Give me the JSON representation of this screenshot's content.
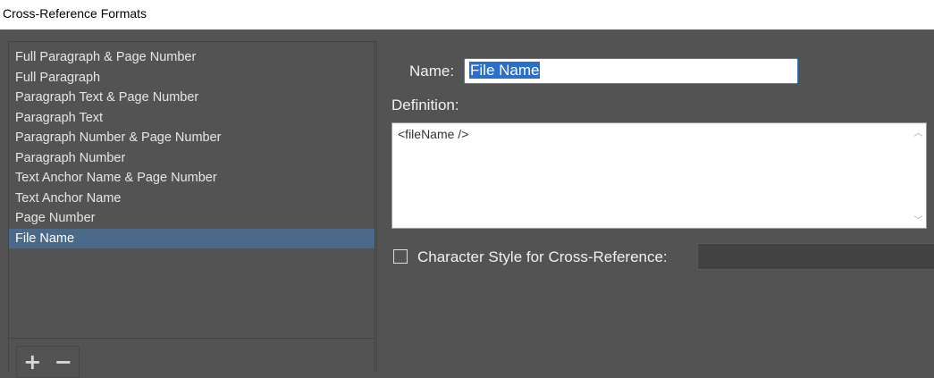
{
  "window": {
    "title": "Cross-Reference Formats"
  },
  "formats": {
    "items": [
      {
        "label": "Full Paragraph & Page Number",
        "selected": false
      },
      {
        "label": "Full Paragraph",
        "selected": false
      },
      {
        "label": "Paragraph Text & Page Number",
        "selected": false
      },
      {
        "label": "Paragraph Text",
        "selected": false
      },
      {
        "label": "Paragraph Number & Page Number",
        "selected": false
      },
      {
        "label": "Paragraph Number",
        "selected": false
      },
      {
        "label": "Text Anchor Name & Page Number",
        "selected": false
      },
      {
        "label": "Text Anchor Name",
        "selected": false
      },
      {
        "label": "Page Number",
        "selected": false
      },
      {
        "label": "File Name",
        "selected": true
      }
    ],
    "add_icon": "+",
    "remove_icon": "−"
  },
  "editor": {
    "name_label": "Name:",
    "name_value": "File Name",
    "definition_label": "Definition:",
    "definition_value": "<fileName />",
    "scroll_up_icon": "︿",
    "scroll_down_icon": "﹀",
    "char_style_checked": false,
    "char_style_label": "Character Style for Cross-Reference:",
    "char_style_value": ""
  },
  "colors": {
    "background": "#535353",
    "selection": "#4b6a8a",
    "input_border": "#3d7bc4",
    "text_highlight": "#2a6fc9"
  }
}
